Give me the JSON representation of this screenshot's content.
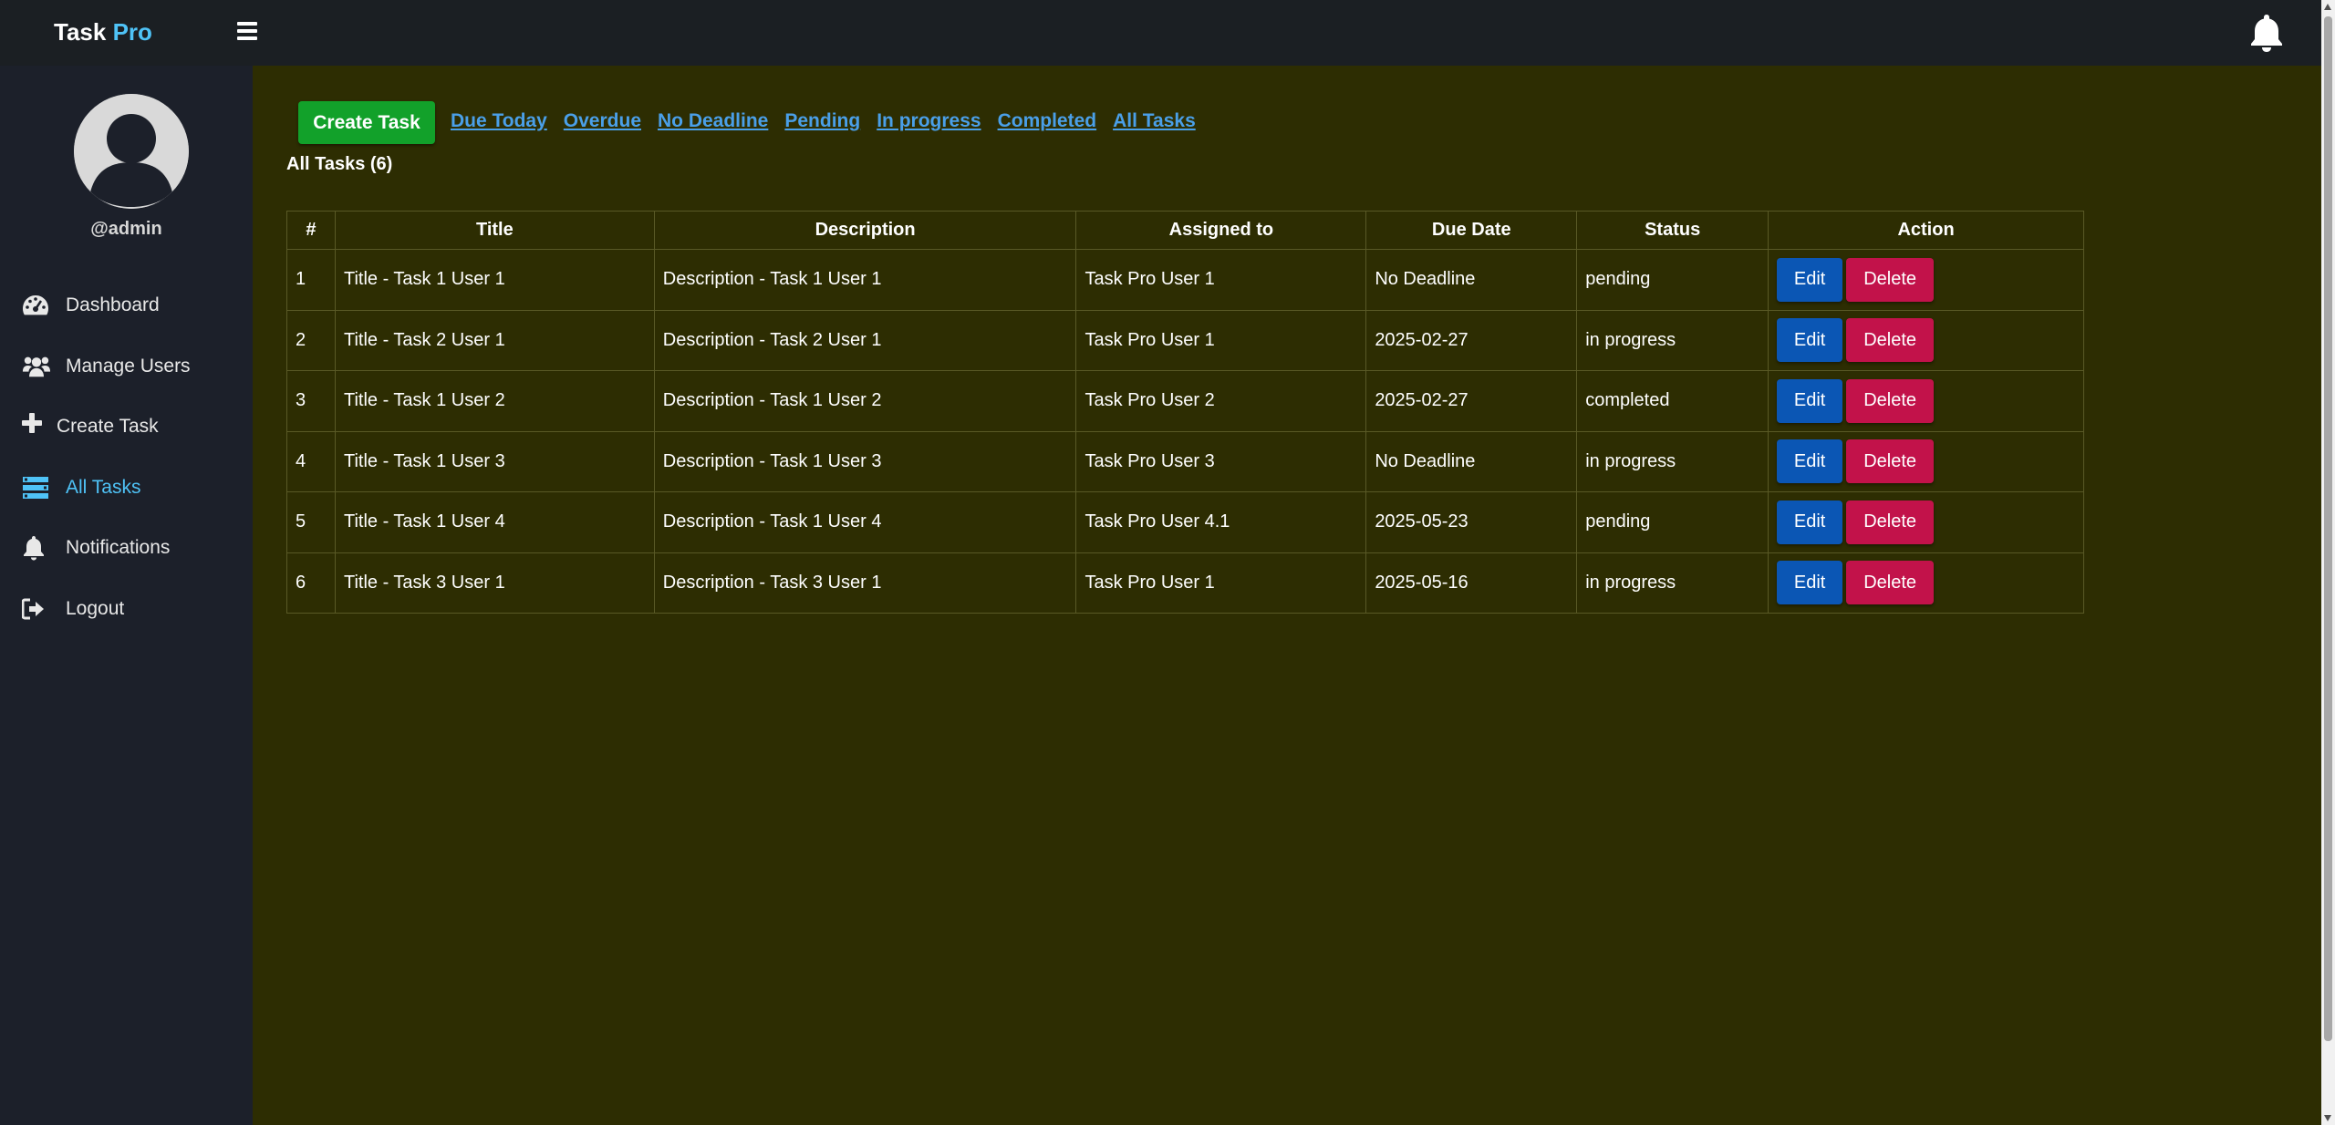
{
  "app": {
    "brand_main": "Task",
    "brand_accent": "Pro",
    "accent_color": "#4fc3f7"
  },
  "header": {
    "menu_icon": "hamburger-icon",
    "notification_icon": "bell-icon"
  },
  "sidebar": {
    "username": "@admin",
    "items": [
      {
        "label": "Dashboard",
        "icon": "dashboard-gauge-icon",
        "active": false
      },
      {
        "label": "Manage Users",
        "icon": "users-icon",
        "active": false
      },
      {
        "label": "Create Task",
        "icon": "plus-icon",
        "active": false
      },
      {
        "label": "All Tasks",
        "icon": "tasks-list-icon",
        "active": true
      },
      {
        "label": "Notifications",
        "icon": "bell-icon",
        "active": false
      },
      {
        "label": "Logout",
        "icon": "sign-out-icon",
        "active": false
      }
    ]
  },
  "toolbar": {
    "create_label": "Create Task",
    "filters": [
      "Due Today",
      "Overdue",
      "No Deadline",
      "Pending",
      "In progress",
      "Completed",
      "All Tasks"
    ]
  },
  "main": {
    "title": "All Tasks (6)"
  },
  "table": {
    "headers": [
      "#",
      "Title",
      "Description",
      "Assigned to",
      "Due Date",
      "Status",
      "Action"
    ],
    "rows": [
      {
        "num": "1",
        "title": "Title - Task 1 User 1",
        "description": "Description - Task 1 User 1",
        "assigned": "Task Pro User 1",
        "due": "No Deadline",
        "status": "pending"
      },
      {
        "num": "2",
        "title": "Title - Task 2 User 1",
        "description": "Description - Task 2 User 1",
        "assigned": "Task Pro User 1",
        "due": "2025-02-27",
        "status": "in progress"
      },
      {
        "num": "3",
        "title": "Title - Task 1 User 2",
        "description": "Description - Task 1 User 2",
        "assigned": "Task Pro User 2",
        "due": "2025-02-27",
        "status": "completed"
      },
      {
        "num": "4",
        "title": "Title - Task 1 User 3",
        "description": "Description - Task 1 User 3",
        "assigned": "Task Pro User 3",
        "due": "No Deadline",
        "status": "in progress"
      },
      {
        "num": "5",
        "title": "Title - Task 1 User 4",
        "description": "Description - Task 1 User 4",
        "assigned": "Task Pro User 4.1",
        "due": "2025-05-23",
        "status": "pending"
      },
      {
        "num": "6",
        "title": "Title - Task 3 User 1",
        "description": "Description - Task 3 User 1",
        "assigned": "Task Pro User 1",
        "due": "2025-05-16",
        "status": "in progress"
      }
    ],
    "edit_label": "Edit",
    "delete_label": "Delete"
  }
}
